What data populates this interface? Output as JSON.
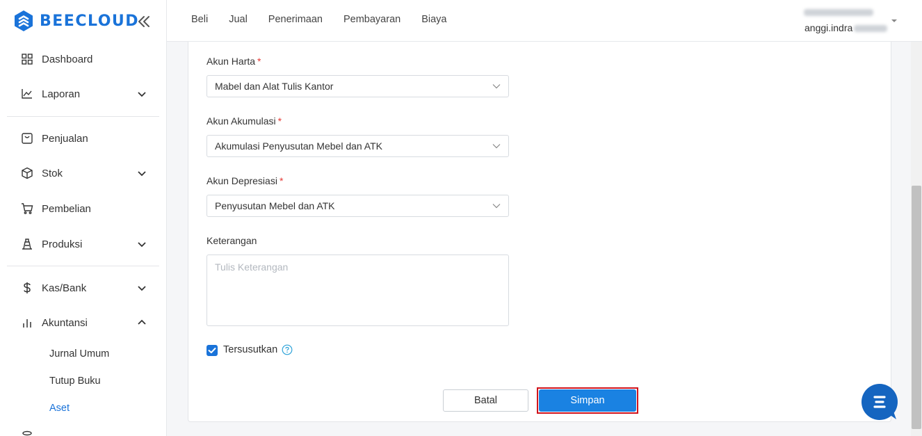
{
  "brand": {
    "name": "BEECLOUD",
    "color": "#1a73d9"
  },
  "sidebar": {
    "items": [
      {
        "label": "Dashboard",
        "icon": "grid-icon"
      },
      {
        "label": "Laporan",
        "icon": "chart-line-icon",
        "expanded": false
      },
      {
        "label": "Penjualan",
        "icon": "bag-icon"
      },
      {
        "label": "Stok",
        "icon": "box-icon",
        "expanded": false
      },
      {
        "label": "Pembelian",
        "icon": "cart-icon"
      },
      {
        "label": "Produksi",
        "icon": "factory-icon",
        "expanded": false
      },
      {
        "label": "Kas/Bank",
        "icon": "dollar-icon",
        "expanded": false
      },
      {
        "label": "Akuntansi",
        "icon": "bar-chart-icon",
        "expanded": true
      }
    ],
    "sub_items": [
      {
        "label": "Jurnal Umum",
        "active": false
      },
      {
        "label": "Tutup Buku",
        "active": false
      },
      {
        "label": "Aset",
        "active": true
      }
    ]
  },
  "header": {
    "nav": [
      "Beli",
      "Jual",
      "Penerimaan",
      "Pembayaran",
      "Biaya"
    ],
    "user": "anggi.indra"
  },
  "form": {
    "akun_harta": {
      "label": "Akun Harta",
      "required": "*",
      "value": "Mabel dan Alat Tulis Kantor"
    },
    "akun_akumulasi": {
      "label": "Akun Akumulasi",
      "required": "*",
      "value": "Akumulasi Penyusutan Mebel dan ATK"
    },
    "akun_depresiasi": {
      "label": "Akun Depresiasi",
      "required": "*",
      "value": "Penyusutan Mebel dan ATK"
    },
    "keterangan": {
      "label": "Keterangan",
      "placeholder": "Tulis Keterangan",
      "value": ""
    },
    "tersusutkan": {
      "label": "Tersusutkan",
      "checked": true
    },
    "cancel_label": "Batal",
    "save_label": "Simpan"
  },
  "colors": {
    "primary": "#1a82e2",
    "highlight": "#d0121b",
    "required": "#e53935"
  }
}
